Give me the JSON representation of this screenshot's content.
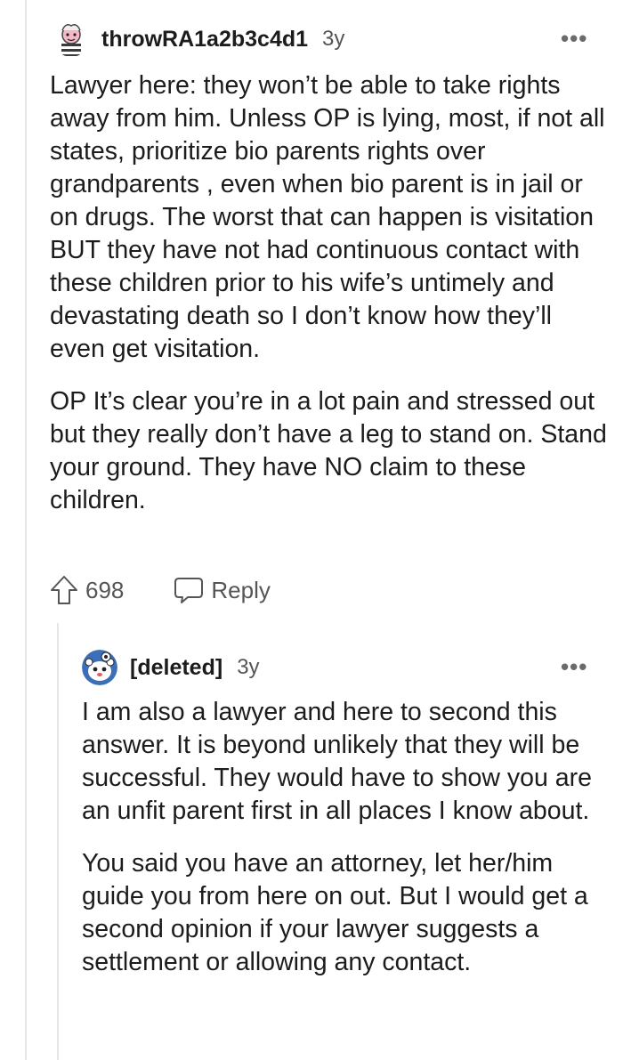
{
  "top_comment": {
    "username": "throwRA1a2b3c4d1",
    "age": "3y",
    "more_label": "•••",
    "paragraphs": [
      "Lawyer here: they won’t be able to take rights away from him. Unless OP is lying, most, if not all states, prioritize bio parents rights over grandparents , even when bio parent is in jail or on drugs. The worst that can happen is visitation BUT they have not had continuous contact with these children prior to his wife’s untimely and devastating death so I don’t know how they’ll even get visitation.",
      "OP It’s clear you’re in a lot pain and stressed out but they really don’t have a leg to stand on. Stand your ground. They have NO claim to these children."
    ],
    "upvote_icon": "upvote-arrow-icon",
    "votes": "698",
    "reply_icon": "speech-bubble-icon",
    "reply_label": "Reply"
  },
  "reply_comment": {
    "username": "[deleted]",
    "age": "3y",
    "more_label": "•••",
    "paragraphs": [
      "I am also a lawyer and here to second this answer. It is beyond unlikely that they will be successful. They would have to show you are an unfit parent first in all places I know about.",
      "You said you have an attorney, let her/him guide you from here on out. But I would get a second opinion if your lawyer suggests a settlement or allowing any contact."
    ]
  },
  "colors": {
    "text": "#1c1c1c",
    "muted": "#555555",
    "thread_line": "#e6e6e6"
  }
}
